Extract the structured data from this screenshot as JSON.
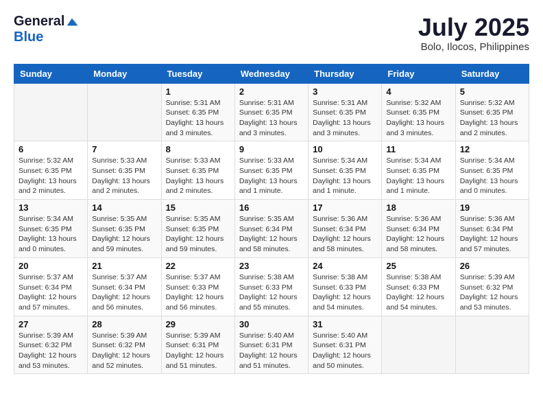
{
  "header": {
    "logo_general": "General",
    "logo_blue": "Blue",
    "month_year": "July 2025",
    "location": "Bolo, Ilocos, Philippines"
  },
  "days_of_week": [
    "Sunday",
    "Monday",
    "Tuesday",
    "Wednesday",
    "Thursday",
    "Friday",
    "Saturday"
  ],
  "weeks": [
    [
      {
        "day": "",
        "info": ""
      },
      {
        "day": "",
        "info": ""
      },
      {
        "day": "1",
        "info": "Sunrise: 5:31 AM\nSunset: 6:35 PM\nDaylight: 13 hours and 3 minutes."
      },
      {
        "day": "2",
        "info": "Sunrise: 5:31 AM\nSunset: 6:35 PM\nDaylight: 13 hours and 3 minutes."
      },
      {
        "day": "3",
        "info": "Sunrise: 5:31 AM\nSunset: 6:35 PM\nDaylight: 13 hours and 3 minutes."
      },
      {
        "day": "4",
        "info": "Sunrise: 5:32 AM\nSunset: 6:35 PM\nDaylight: 13 hours and 3 minutes."
      },
      {
        "day": "5",
        "info": "Sunrise: 5:32 AM\nSunset: 6:35 PM\nDaylight: 13 hours and 2 minutes."
      }
    ],
    [
      {
        "day": "6",
        "info": "Sunrise: 5:32 AM\nSunset: 6:35 PM\nDaylight: 13 hours and 2 minutes."
      },
      {
        "day": "7",
        "info": "Sunrise: 5:33 AM\nSunset: 6:35 PM\nDaylight: 13 hours and 2 minutes."
      },
      {
        "day": "8",
        "info": "Sunrise: 5:33 AM\nSunset: 6:35 PM\nDaylight: 13 hours and 2 minutes."
      },
      {
        "day": "9",
        "info": "Sunrise: 5:33 AM\nSunset: 6:35 PM\nDaylight: 13 hours and 1 minute."
      },
      {
        "day": "10",
        "info": "Sunrise: 5:34 AM\nSunset: 6:35 PM\nDaylight: 13 hours and 1 minute."
      },
      {
        "day": "11",
        "info": "Sunrise: 5:34 AM\nSunset: 6:35 PM\nDaylight: 13 hours and 1 minute."
      },
      {
        "day": "12",
        "info": "Sunrise: 5:34 AM\nSunset: 6:35 PM\nDaylight: 13 hours and 0 minutes."
      }
    ],
    [
      {
        "day": "13",
        "info": "Sunrise: 5:34 AM\nSunset: 6:35 PM\nDaylight: 13 hours and 0 minutes."
      },
      {
        "day": "14",
        "info": "Sunrise: 5:35 AM\nSunset: 6:35 PM\nDaylight: 12 hours and 59 minutes."
      },
      {
        "day": "15",
        "info": "Sunrise: 5:35 AM\nSunset: 6:35 PM\nDaylight: 12 hours and 59 minutes."
      },
      {
        "day": "16",
        "info": "Sunrise: 5:35 AM\nSunset: 6:34 PM\nDaylight: 12 hours and 58 minutes."
      },
      {
        "day": "17",
        "info": "Sunrise: 5:36 AM\nSunset: 6:34 PM\nDaylight: 12 hours and 58 minutes."
      },
      {
        "day": "18",
        "info": "Sunrise: 5:36 AM\nSunset: 6:34 PM\nDaylight: 12 hours and 58 minutes."
      },
      {
        "day": "19",
        "info": "Sunrise: 5:36 AM\nSunset: 6:34 PM\nDaylight: 12 hours and 57 minutes."
      }
    ],
    [
      {
        "day": "20",
        "info": "Sunrise: 5:37 AM\nSunset: 6:34 PM\nDaylight: 12 hours and 57 minutes."
      },
      {
        "day": "21",
        "info": "Sunrise: 5:37 AM\nSunset: 6:34 PM\nDaylight: 12 hours and 56 minutes."
      },
      {
        "day": "22",
        "info": "Sunrise: 5:37 AM\nSunset: 6:33 PM\nDaylight: 12 hours and 56 minutes."
      },
      {
        "day": "23",
        "info": "Sunrise: 5:38 AM\nSunset: 6:33 PM\nDaylight: 12 hours and 55 minutes."
      },
      {
        "day": "24",
        "info": "Sunrise: 5:38 AM\nSunset: 6:33 PM\nDaylight: 12 hours and 54 minutes."
      },
      {
        "day": "25",
        "info": "Sunrise: 5:38 AM\nSunset: 6:33 PM\nDaylight: 12 hours and 54 minutes."
      },
      {
        "day": "26",
        "info": "Sunrise: 5:39 AM\nSunset: 6:32 PM\nDaylight: 12 hours and 53 minutes."
      }
    ],
    [
      {
        "day": "27",
        "info": "Sunrise: 5:39 AM\nSunset: 6:32 PM\nDaylight: 12 hours and 53 minutes."
      },
      {
        "day": "28",
        "info": "Sunrise: 5:39 AM\nSunset: 6:32 PM\nDaylight: 12 hours and 52 minutes."
      },
      {
        "day": "29",
        "info": "Sunrise: 5:39 AM\nSunset: 6:31 PM\nDaylight: 12 hours and 51 minutes."
      },
      {
        "day": "30",
        "info": "Sunrise: 5:40 AM\nSunset: 6:31 PM\nDaylight: 12 hours and 51 minutes."
      },
      {
        "day": "31",
        "info": "Sunrise: 5:40 AM\nSunset: 6:31 PM\nDaylight: 12 hours and 50 minutes."
      },
      {
        "day": "",
        "info": ""
      },
      {
        "day": "",
        "info": ""
      }
    ]
  ]
}
